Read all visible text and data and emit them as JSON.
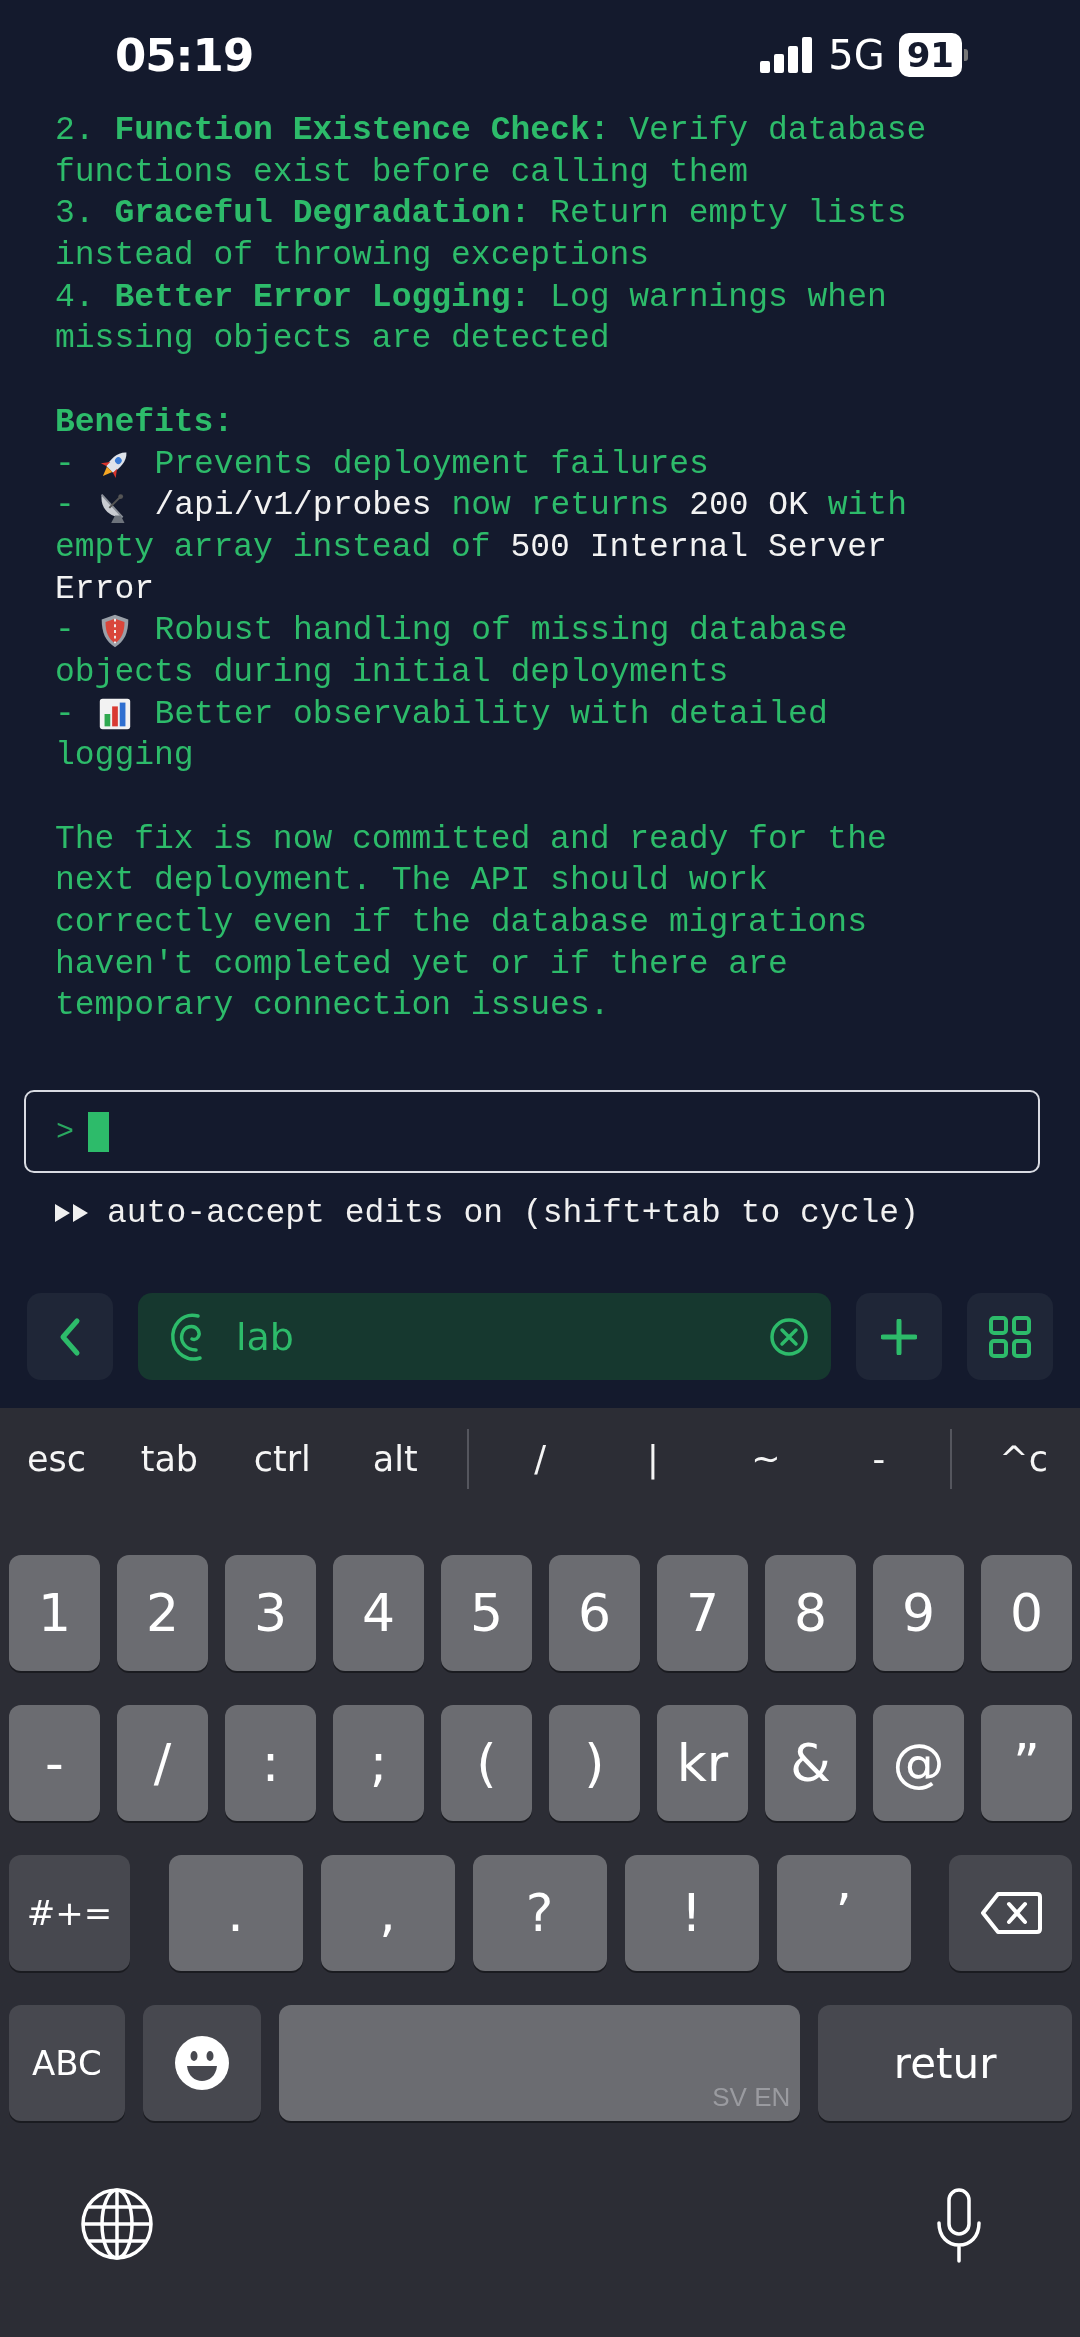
{
  "status_bar": {
    "time": "05:19",
    "network": "5G",
    "battery": "91"
  },
  "terminal": {
    "lines": [
      {
        "kind": "text",
        "segments": [
          {
            "kind": "plain",
            "text": "2. "
          },
          {
            "kind": "bold",
            "text": "Function Existence Check:"
          },
          {
            "kind": "plain",
            "text": " Verify database"
          }
        ]
      },
      {
        "kind": "text",
        "segments": [
          {
            "kind": "plain",
            "text": "functions exist before calling them"
          }
        ]
      },
      {
        "kind": "text",
        "segments": [
          {
            "kind": "plain",
            "text": "3. "
          },
          {
            "kind": "bold",
            "text": "Graceful Degradation:"
          },
          {
            "kind": "plain",
            "text": " Return empty lists"
          }
        ]
      },
      {
        "kind": "text",
        "segments": [
          {
            "kind": "plain",
            "text": "instead of throwing exceptions"
          }
        ]
      },
      {
        "kind": "text",
        "segments": [
          {
            "kind": "plain",
            "text": "4. "
          },
          {
            "kind": "bold",
            "text": "Better Error Logging:"
          },
          {
            "kind": "plain",
            "text": " Log warnings when"
          }
        ]
      },
      {
        "kind": "text",
        "segments": [
          {
            "kind": "plain",
            "text": "missing objects are detected"
          }
        ]
      },
      {
        "kind": "blank"
      },
      {
        "kind": "text",
        "segments": [
          {
            "kind": "bold",
            "text": "Benefits:"
          }
        ]
      },
      {
        "kind": "text",
        "segments": [
          {
            "kind": "plain",
            "text": "- "
          },
          {
            "kind": "icon"
          },
          {
            "kind": "plain",
            "text": " Prevents deployment failures"
          }
        ]
      },
      {
        "kind": "text",
        "segments": [
          {
            "kind": "plain",
            "text": "- "
          },
          {
            "kind": "icon"
          },
          {
            "kind": "code",
            "text": " /api/v1/probes"
          },
          {
            "kind": "plain",
            "text": " now returns "
          },
          {
            "kind": "code",
            "text": "200 OK"
          },
          {
            "kind": "plain",
            "text": " with"
          }
        ]
      },
      {
        "kind": "text",
        "segments": [
          {
            "kind": "plain",
            "text": "empty array instead of "
          },
          {
            "kind": "code",
            "text": "500 Internal Server"
          }
        ]
      },
      {
        "kind": "text",
        "segments": [
          {
            "kind": "code",
            "text": "Error"
          }
        ]
      },
      {
        "kind": "text",
        "segments": [
          {
            "kind": "plain",
            "text": "- "
          },
          {
            "kind": "icon"
          },
          {
            "kind": "plain",
            "text": " Robust handling of missing database"
          }
        ]
      },
      {
        "kind": "text",
        "segments": [
          {
            "kind": "plain",
            "text": "objects during initial deployments"
          }
        ]
      },
      {
        "kind": "text",
        "segments": [
          {
            "kind": "plain",
            "text": "- "
          },
          {
            "kind": "icon"
          },
          {
            "kind": "plain",
            "text": " Better observability with detailed"
          }
        ]
      },
      {
        "kind": "text",
        "segments": [
          {
            "kind": "plain",
            "text": "logging"
          }
        ]
      },
      {
        "kind": "blank"
      },
      {
        "kind": "text",
        "segments": [
          {
            "kind": "plain",
            "text": "The fix is now committed and ready for the"
          }
        ]
      },
      {
        "kind": "text",
        "segments": [
          {
            "kind": "plain",
            "text": "next deployment. The API should work"
          }
        ]
      },
      {
        "kind": "text",
        "segments": [
          {
            "kind": "plain",
            "text": "correctly even if the database migrations"
          }
        ]
      },
      {
        "kind": "text",
        "segments": [
          {
            "kind": "plain",
            "text": "haven't completed yet or if there are"
          }
        ]
      },
      {
        "kind": "text",
        "segments": [
          {
            "kind": "plain",
            "text": "temporary connection issues."
          }
        ]
      }
    ]
  },
  "prompt": {
    "symbol": ">"
  },
  "mode_line": "auto-accept edits on (shift+tab to cycle)",
  "toolbar": {
    "session": "lab"
  },
  "keyboard": {
    "accessory_keys": [
      {
        "kind": "key",
        "label": "esc"
      },
      {
        "kind": "key",
        "label": "tab"
      },
      {
        "kind": "key",
        "label": "ctrl"
      },
      {
        "kind": "key",
        "label": "alt"
      },
      {
        "kind": "separator"
      },
      {
        "kind": "key",
        "label": "/"
      },
      {
        "kind": "key",
        "label": "|"
      },
      {
        "kind": "key",
        "label": "~"
      },
      {
        "kind": "key",
        "label": "-"
      },
      {
        "kind": "separator"
      },
      {
        "kind": "key",
        "label": "^c"
      }
    ],
    "rows": [
      {
        "keys": [
          {
            "kind": "char",
            "label": "1"
          },
          {
            "kind": "char",
            "label": "2"
          },
          {
            "kind": "char",
            "label": "3"
          },
          {
            "kind": "char",
            "label": "4"
          },
          {
            "kind": "char",
            "label": "5"
          },
          {
            "kind": "char",
            "label": "6"
          },
          {
            "kind": "char",
            "label": "7"
          },
          {
            "kind": "char",
            "label": "8"
          },
          {
            "kind": "char",
            "label": "9"
          },
          {
            "kind": "char",
            "label": "0"
          }
        ]
      },
      {
        "keys": [
          {
            "kind": "char",
            "label": "-"
          },
          {
            "kind": "char",
            "label": "/"
          },
          {
            "kind": "char",
            "label": ":"
          },
          {
            "kind": "char",
            "label": ";"
          },
          {
            "kind": "char",
            "label": "("
          },
          {
            "kind": "char",
            "label": ")"
          },
          {
            "kind": "char",
            "label": "kr"
          },
          {
            "kind": "char",
            "label": "&"
          },
          {
            "kind": "char",
            "label": "@"
          },
          {
            "kind": "char",
            "label": "”"
          }
        ]
      },
      {
        "keys": [
          {
            "kind": "mode",
            "label": "#+="
          },
          {
            "kind": "wide",
            "label": "."
          },
          {
            "kind": "wide",
            "label": ","
          },
          {
            "kind": "wide",
            "label": "?"
          },
          {
            "kind": "wide",
            "label": "!"
          },
          {
            "kind": "wide",
            "label": "’"
          },
          {
            "kind": "backspace"
          }
        ]
      },
      {
        "keys": [
          {
            "kind": "mode",
            "label": "ABC"
          },
          {
            "kind": "emoji"
          },
          {
            "kind": "space",
            "label": "SV EN"
          },
          {
            "kind": "return",
            "label": "retur"
          }
        ]
      }
    ]
  }
}
